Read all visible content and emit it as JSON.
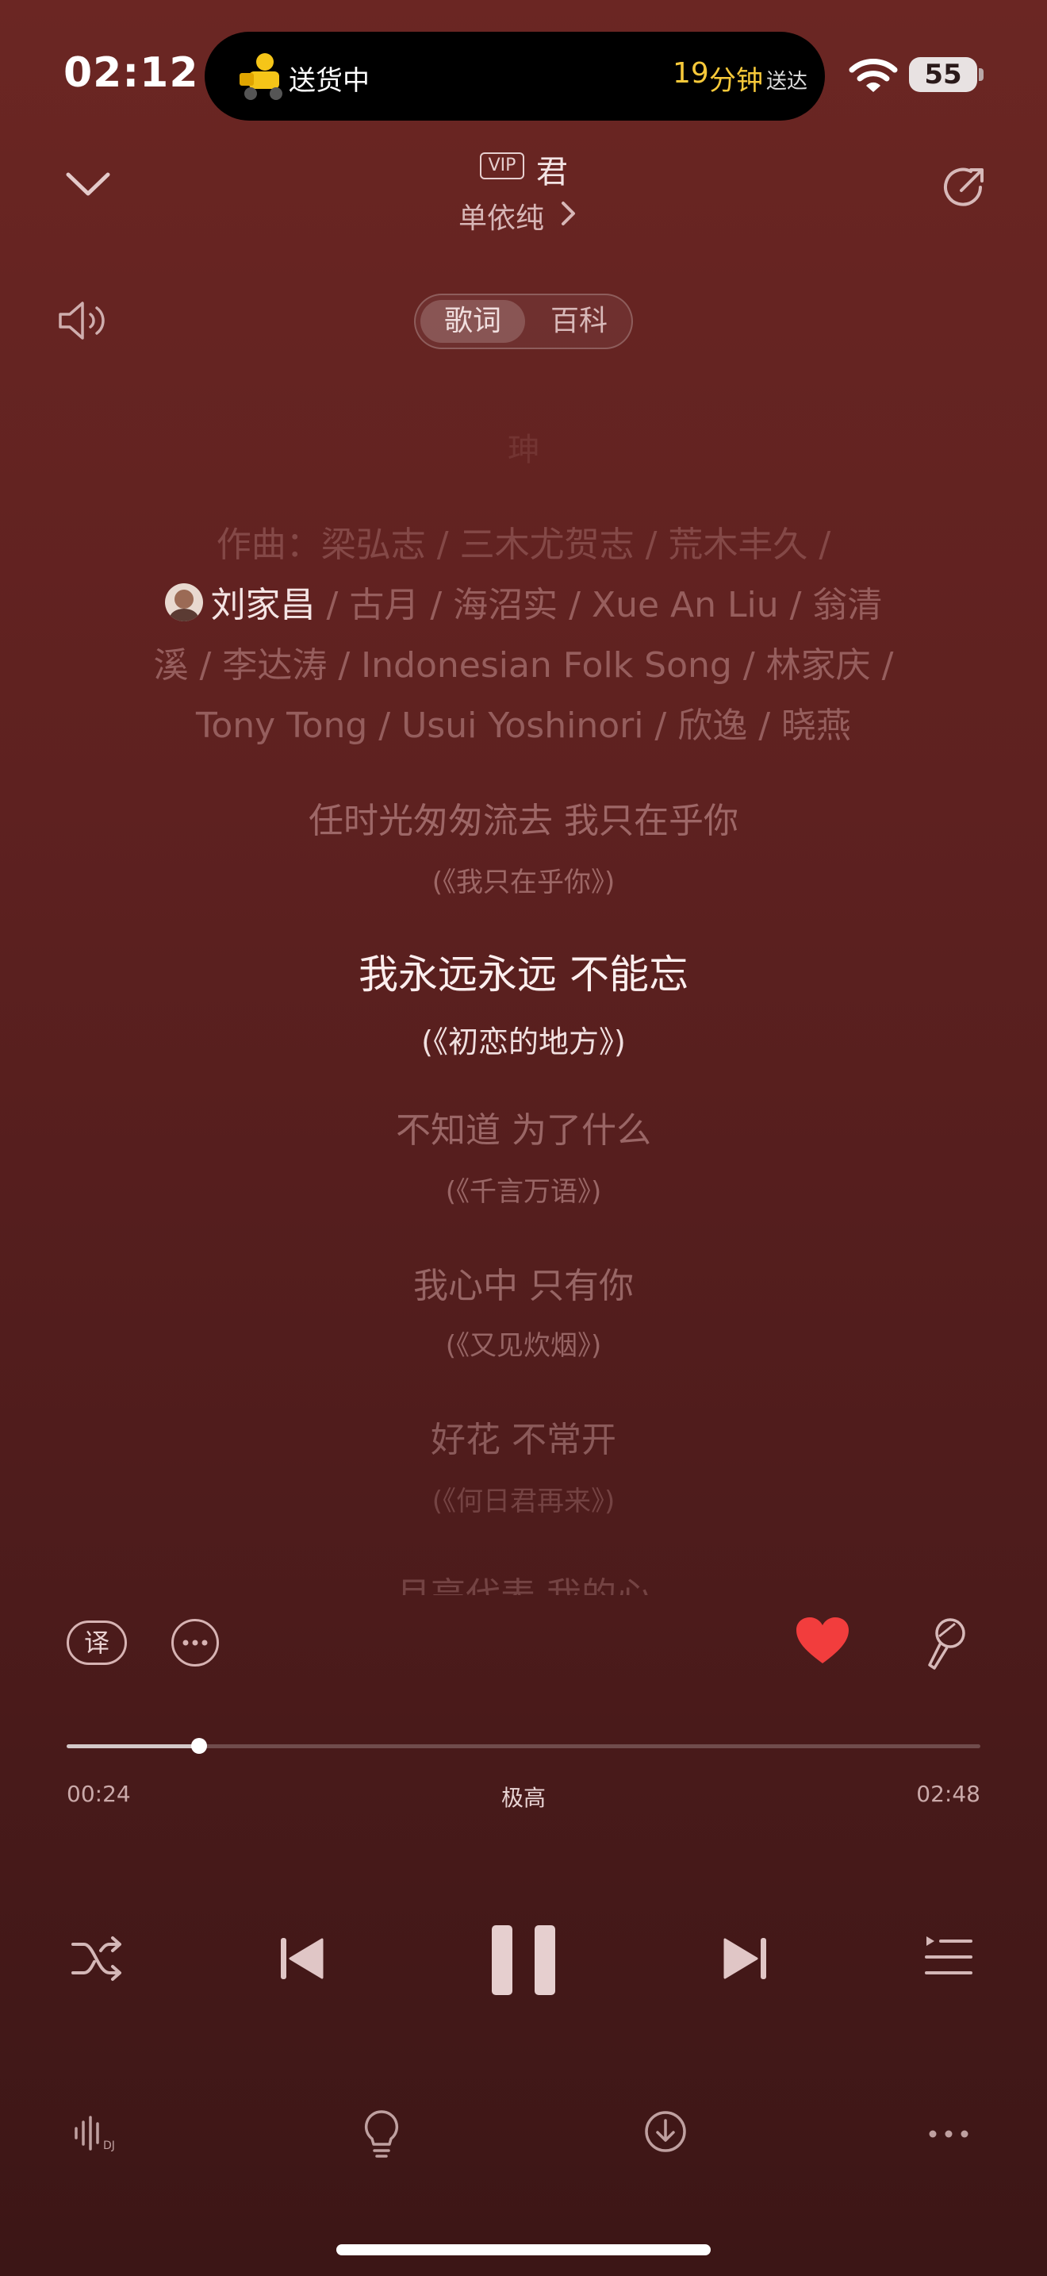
{
  "status": {
    "time": "02:12",
    "delivery_label": "送货中",
    "eta_number": "19",
    "eta_unit": "分钟",
    "eta_suffix": "送达",
    "battery": "55"
  },
  "header": {
    "vip_badge": "VIP",
    "song_title": "君",
    "artist": "单依纯"
  },
  "tabs": {
    "lyrics": "歌词",
    "wiki": "百科"
  },
  "lyrics": {
    "top_fade": "珅",
    "credits": [
      "作曲：梁弘志 / 三木尤贺志 / 荒木丰久 /",
      "刘家昌",
      " / 古月 / 海沼实 / Xue An Liu / 翁清",
      "溪 / 李达涛 / Indonesian Folk Song / 林家庆 /",
      "Tony Tong / Usui Yoshinori / 欣逸 / 晓燕"
    ],
    "lines": [
      {
        "text": "任时光匆匆流去 我只在乎你",
        "source": "(《我只在乎你》)"
      },
      {
        "text": "我永远永远 不能忘",
        "source": "(《初恋的地方》)"
      },
      {
        "text": "不知道 为了什么",
        "source": "(《千言万语》)"
      },
      {
        "text": "我心中 只有你",
        "source": "(《又见炊烟》)"
      },
      {
        "text": "好花 不常开",
        "source": "(《何日君再来》)"
      },
      {
        "text": "月亮代表 我的心",
        "source": ""
      }
    ]
  },
  "actions": {
    "translate_label": "译"
  },
  "progress": {
    "current": "00:24",
    "quality": "极高",
    "total": "02:48",
    "fraction": 0.145
  },
  "colors": {
    "accent_heart": "#f23d3d",
    "background_top": "#6b2623",
    "background_bottom": "#3c1616"
  },
  "icons": [
    "chevron-down-icon",
    "share-icon",
    "speaker-icon",
    "translate-icon",
    "more-icon",
    "heart-icon",
    "microphone-icon",
    "shuffle-icon",
    "previous-icon",
    "pause-icon",
    "next-icon",
    "queue-icon",
    "dj-icon",
    "bulb-icon",
    "download-icon",
    "ellipsis-icon"
  ]
}
